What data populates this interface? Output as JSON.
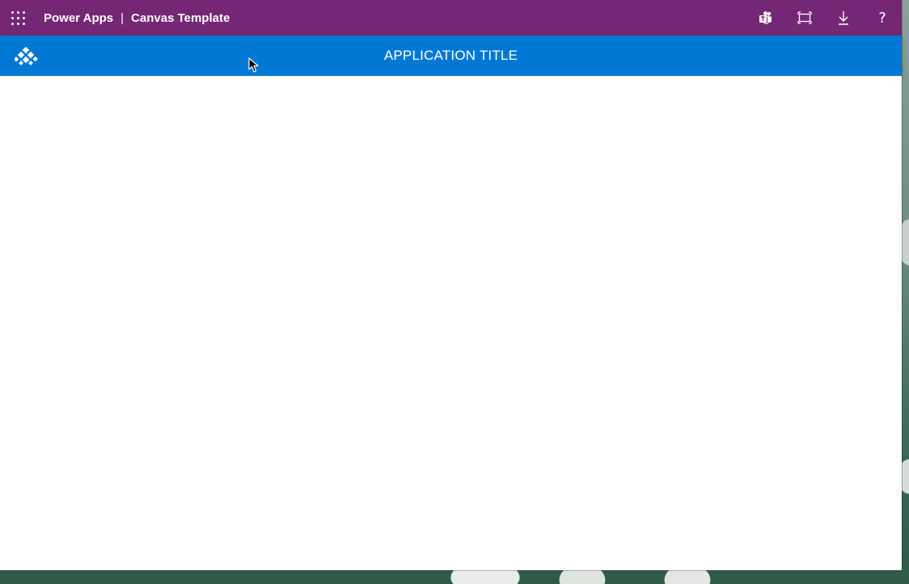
{
  "topbar": {
    "app_name": "Power Apps",
    "separator": "|",
    "app_title": "Canvas Template",
    "icons": {
      "launcher": "waffle-icon",
      "teams": "teams-icon",
      "fit": "fit-to-window-icon",
      "download": "download-icon",
      "help": "help-icon"
    },
    "help_glyph": "?",
    "background": "#742774"
  },
  "appbar": {
    "title": "APPLICATION TITLE",
    "logo_icon": "diamond-pattern-logo-icon",
    "background": "#0078d4"
  }
}
